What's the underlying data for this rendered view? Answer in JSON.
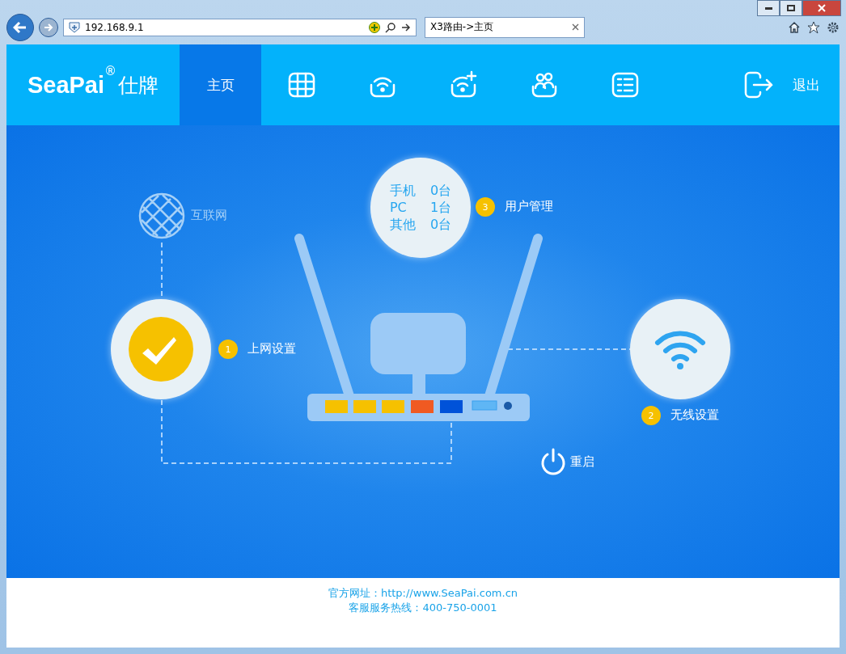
{
  "browser": {
    "address": "192.168.9.1",
    "tab_title": "X3路由->主页"
  },
  "header": {
    "logo": {
      "brand": "SeaPai",
      "mark": "®",
      "name": "仕牌"
    },
    "nav": [
      {
        "kind": "text",
        "label": "主页",
        "selected": true
      },
      {
        "kind": "grid",
        "selected": false
      },
      {
        "kind": "wifi",
        "selected": false
      },
      {
        "kind": "wifiadd",
        "selected": false
      },
      {
        "kind": "users",
        "selected": false
      },
      {
        "kind": "list",
        "selected": false
      }
    ],
    "logout": "退出"
  },
  "diagram": {
    "internet": "互联网",
    "devices": [
      {
        "name": "手机",
        "count": "0台"
      },
      {
        "name": "PC",
        "count": "1台"
      },
      {
        "name": "其他",
        "count": "0台"
      }
    ],
    "steps": [
      {
        "number": "1",
        "label": "上网设置"
      },
      {
        "number": "2",
        "label": "无线设置"
      },
      {
        "number": "3",
        "label": "用户管理"
      }
    ],
    "restart": "重启"
  },
  "footer": [
    "官方网址：http://www.SeaPai.com.cn",
    "客服服务热线：400-750-0001"
  ]
}
